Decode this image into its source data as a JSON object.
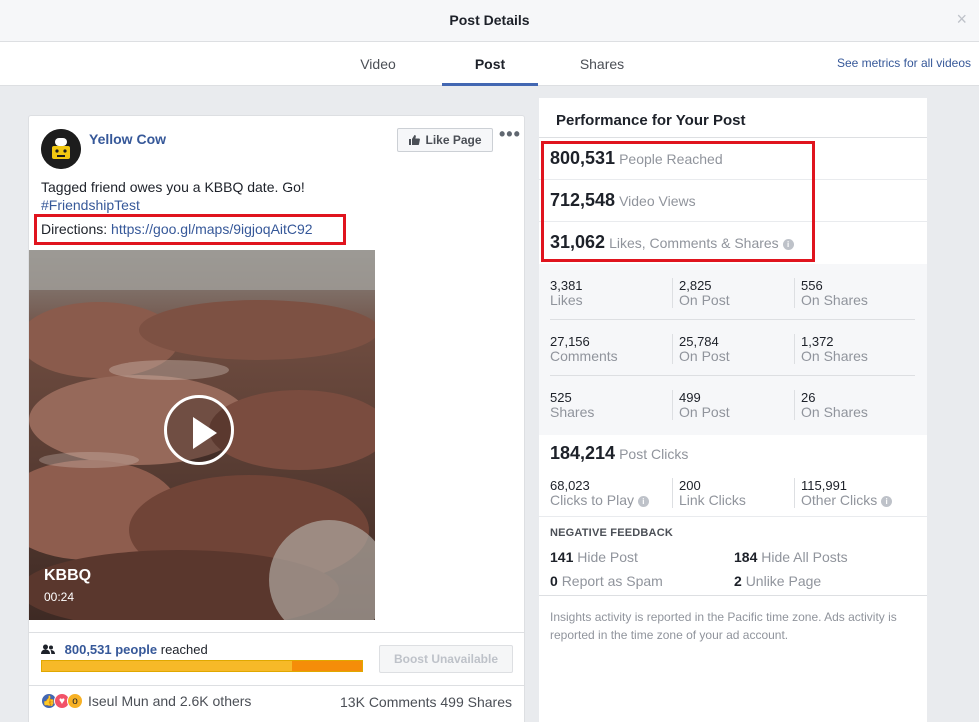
{
  "header": {
    "title": "Post Details",
    "close": "×"
  },
  "tabs": [
    {
      "label": "Video"
    },
    {
      "label": "Post",
      "active": true
    },
    {
      "label": "Shares"
    }
  ],
  "see_metrics_link": "See metrics for all videos",
  "post": {
    "page_name": "Yellow Cow",
    "like_page_label": "Like Page",
    "more_label": "•••",
    "text": "Tagged friend owes you a KBBQ date. Go!",
    "hashtag": "#FriendshipTest",
    "directions_label": "Directions:",
    "directions_url": "https://goo.gl/maps/9igjoqAitC92",
    "video": {
      "title": "KBBQ",
      "duration": "00:24",
      "reach_fraction_organic": 0.78
    },
    "reach_number": "800,531 people",
    "reach_suffix": "reached",
    "boost_label": "Boost Unavailable",
    "reactions_text": "Iseul Mun and 2.6K others",
    "counts_text": "13K Comments  499 Shares"
  },
  "metrics": {
    "title": "Performance for Your Post",
    "people_reached": {
      "value": "800,531",
      "label": "People Reached"
    },
    "video_views": {
      "value": "712,548",
      "label": "Video Views"
    },
    "engagement": {
      "value": "31,062",
      "label": "Likes, Comments & Shares"
    },
    "grid": [
      [
        {
          "v": "3,381",
          "l": "Likes"
        },
        {
          "v": "2,825",
          "l": "On Post"
        },
        {
          "v": "556",
          "l": "On Shares"
        }
      ],
      [
        {
          "v": "27,156",
          "l": "Comments"
        },
        {
          "v": "25,784",
          "l": "On Post"
        },
        {
          "v": "1,372",
          "l": "On Shares"
        }
      ],
      [
        {
          "v": "525",
          "l": "Shares"
        },
        {
          "v": "499",
          "l": "On Post"
        },
        {
          "v": "26",
          "l": "On Shares"
        }
      ]
    ],
    "post_clicks": {
      "value": "184,214",
      "label": "Post Clicks"
    },
    "clicks": [
      {
        "v": "68,023",
        "l": "Clicks to Play"
      },
      {
        "v": "200",
        "l": "Link Clicks"
      },
      {
        "v": "115,991",
        "l": "Other Clicks"
      }
    ],
    "negative_title": "NEGATIVE FEEDBACK",
    "negative": [
      {
        "n": "141",
        "l": "Hide Post"
      },
      {
        "n": "184",
        "l": "Hide All Posts"
      },
      {
        "n": "0",
        "l": "Report as Spam"
      },
      {
        "n": "2",
        "l": "Unlike Page"
      }
    ],
    "footnote": "Insights activity is reported in the Pacific time zone. Ads activity is reported in the time zone of your ad account."
  },
  "colors": {
    "brand_blue": "#4267b2",
    "link": "#365899",
    "highlight": "#e0141e",
    "reach_organic": "#f7b928",
    "reach_paid": "#f58d09"
  }
}
